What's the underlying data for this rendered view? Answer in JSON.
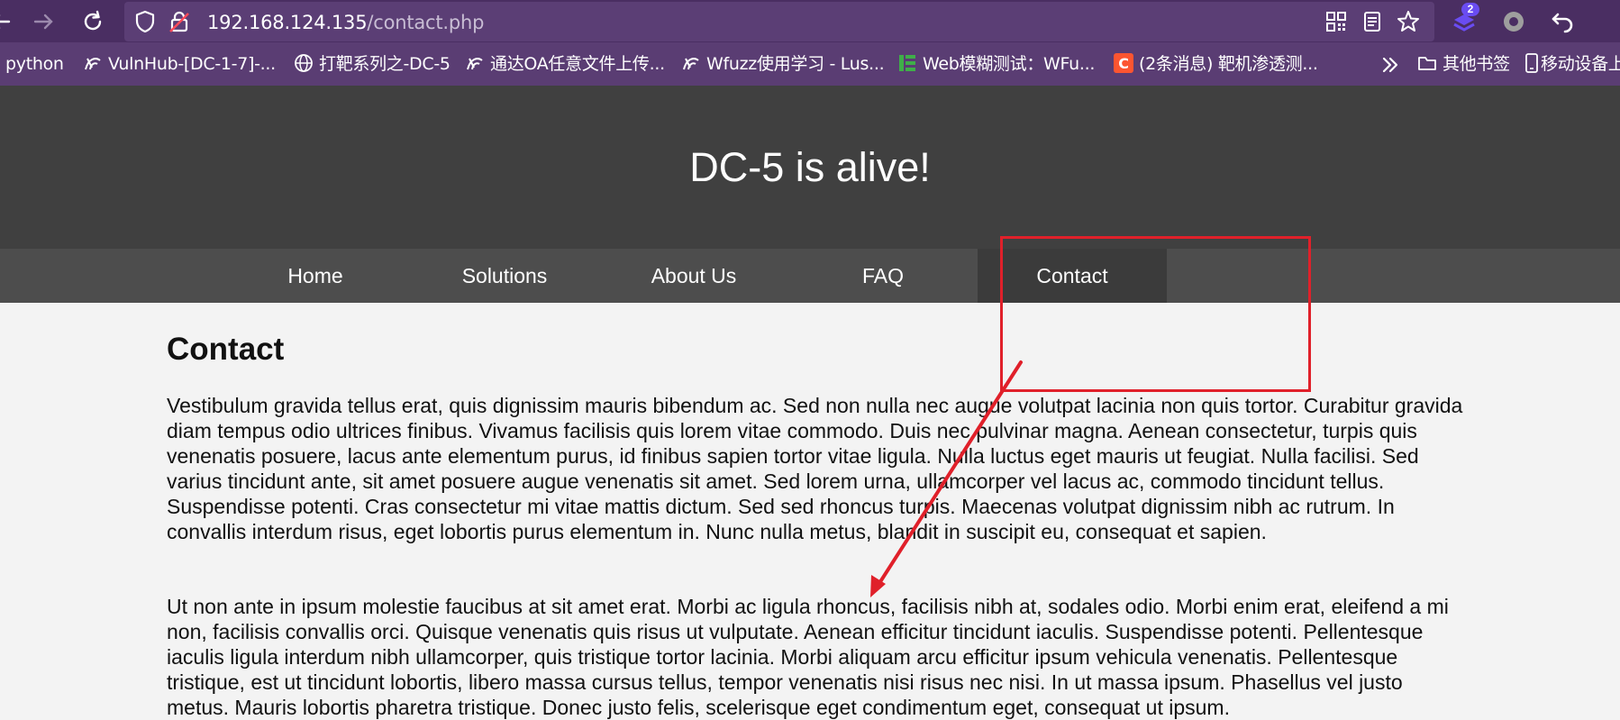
{
  "browser": {
    "url_host": "192.168.124.135",
    "url_path": "/contact.php",
    "extension_badge": "2",
    "bookmarks": [
      {
        "label": "python",
        "icon": "none"
      },
      {
        "label": "VulnHub-[DC-1-7]-...",
        "icon": "vulnhub-icon"
      },
      {
        "label": "打靶系列之-DC-5",
        "icon": "globe-icon"
      },
      {
        "label": "通达OA任意文件上传...",
        "icon": "vulnhub-icon"
      },
      {
        "label": "Wfuzz使用学习 - Lus...",
        "icon": "vulnhub-icon"
      },
      {
        "label": "Web模糊测试：WFu...",
        "icon": "green-bars-icon"
      },
      {
        "label": "(2条消息) 靶机渗透测...",
        "icon": "csdn-icon"
      },
      {
        "label": "其他书签",
        "icon": "folder-icon"
      },
      {
        "label": "移动设备上",
        "icon": "mobile-icon"
      }
    ]
  },
  "site": {
    "title": "DC-5 is alive!",
    "nav": [
      {
        "label": "Home",
        "active": false
      },
      {
        "label": "Solutions",
        "active": false
      },
      {
        "label": "About Us",
        "active": false
      },
      {
        "label": "FAQ",
        "active": false
      },
      {
        "label": "Contact",
        "active": true
      }
    ],
    "heading": "Contact",
    "paragraphs": [
      "Vestibulum gravida tellus erat, quis dignissim mauris bibendum ac. Sed non nulla nec augue volutpat lacinia non quis tortor. Curabitur gravida diam tempus odio ultrices finibus. Vivamus facilisis quis lorem vitae commodo. Duis nec pulvinar magna. Aenean consectetur, turpis quis venenatis posuere, lacus ante elementum purus, id finibus sapien tortor vitae ligula. Nulla luctus eget mauris ut feugiat. Nulla facilisi. Sed varius tincidunt ante, sit amet posuere augue venenatis sit amet. Sed lorem urna, ullamcorper vel lacus ac, commodo tincidunt tellus. Suspendisse potenti. Cras consectetur mi vitae mattis dictum. Sed sed rhoncus turpis. Maecenas volutpat dignissim nibh ac rutrum. In convallis interdum risus, eget lobortis purus elementum in. Nunc nulla metus, blandit in suscipit eu, consequat et sapien.",
      "Ut non ante in ipsum molestie faucibus at sit amet erat. Morbi ac ligula rhoncus, facilisis nibh at, sodales odio. Morbi enim erat, eleifend a mi non, facilisis convallis orci. Quisque venenatis quis risus ut vulputate. Aenean efficitur tincidunt iaculis. Suspendisse potenti. Pellentesque iaculis ligula interdum nibh ullamcorper, quis tristique tortor lacinia. Morbi aliquam arcu efficitur ipsum vehicula venenatis. Pellentesque tristique, est ut tincidunt lobortis, libero massa cursus tellus, tempor venenatis nisi risus nec nisi. In ut massa ipsum. Phasellus vel justo metus. Mauris lobortis pharetra tristique. Donec justo felis, scelerisque eget condimentum eget, consequat ut ipsum."
    ]
  },
  "colors": {
    "browser_toolbar": "#4a2e62",
    "bookmarks_bar": "#5a3d73",
    "site_header": "#404040",
    "site_nav": "#4d4d4d",
    "nav_active": "#3b3b3b",
    "annotation": "#e0202a"
  }
}
